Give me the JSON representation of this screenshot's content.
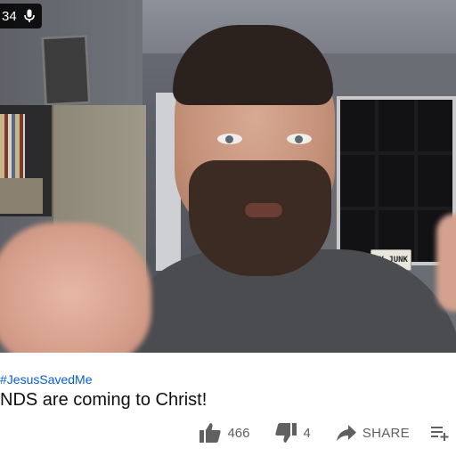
{
  "player": {
    "time_display": "34",
    "mic_icon": "mic-icon",
    "background_plate_text": "MY JUNK"
  },
  "video_info": {
    "hashtag": "#JesusSavedMe",
    "title": "NDS are coming to Christ!"
  },
  "actions": {
    "like_count": "466",
    "dislike_count": "4",
    "share_label": "SHARE",
    "icons": [
      "thumb-up-icon",
      "thumb-down-icon",
      "share-arrow-icon",
      "add-to-playlist-icon"
    ]
  },
  "colors": {
    "link_blue": "#065fd4",
    "title_text": "#0f0f0f",
    "secondary_text": "#606060"
  }
}
